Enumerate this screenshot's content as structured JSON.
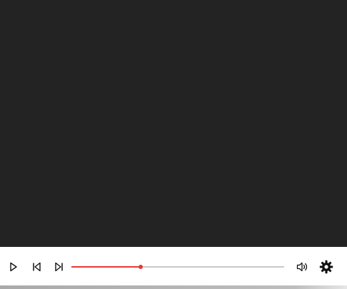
{
  "player": {
    "playback_progress": 0.325,
    "accent_color": "#e53935",
    "video_background": "#232323"
  },
  "controls": {
    "play_icon": "play-icon",
    "previous_icon": "skip-previous-icon",
    "next_icon": "skip-next-icon",
    "volume_icon": "volume-icon",
    "settings_icon": "gear-icon"
  }
}
